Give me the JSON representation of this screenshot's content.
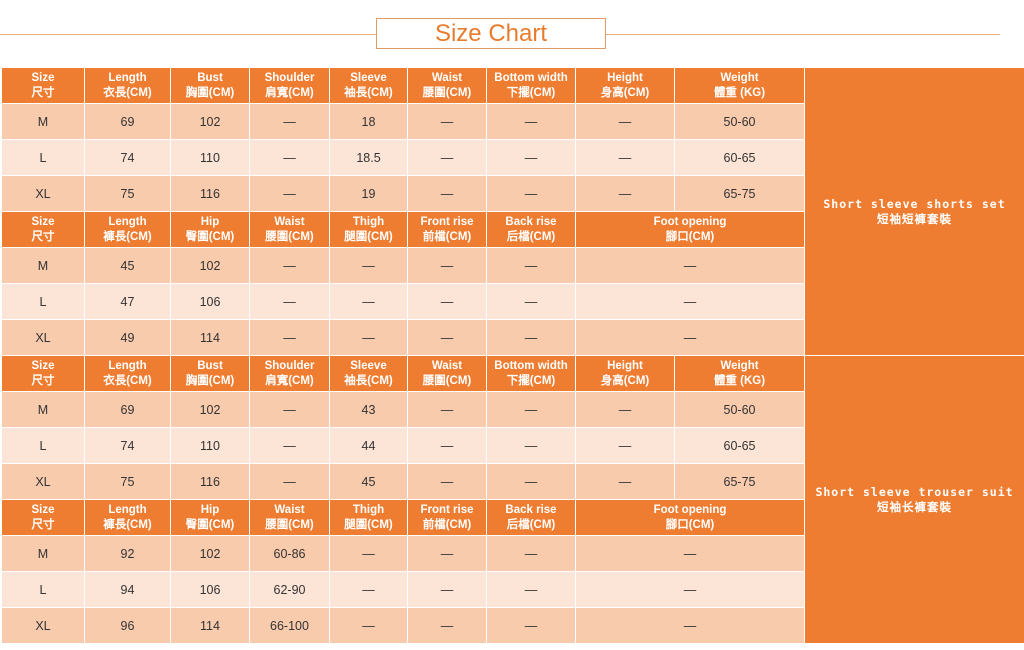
{
  "title": "Size Chart",
  "sets": [
    {
      "label_en": "Short sleeve shorts set",
      "label_zh": "短袖短褲套裝",
      "tables": [
        {
          "headers": [
            {
              "en": "Size",
              "zh": "尺寸",
              "span": 1
            },
            {
              "en": "Length",
              "zh": "衣長(CM)",
              "span": 1
            },
            {
              "en": "Bust",
              "zh": "胸圍(CM)",
              "span": 1
            },
            {
              "en": "Shoulder",
              "zh": "肩寬(CM)",
              "span": 1
            },
            {
              "en": "Sleeve",
              "zh": "袖長(CM)",
              "span": 1
            },
            {
              "en": "Waist",
              "zh": "腰圍(CM)",
              "span": 1
            },
            {
              "en": "Bottom width",
              "zh": "下擺(CM)",
              "span": 1
            },
            {
              "en": "Height",
              "zh": "身高(CM)",
              "span": 1
            },
            {
              "en": "Weight",
              "zh": "體重 (KG)",
              "span": 1
            }
          ],
          "rows": [
            {
              "cells": [
                "M",
                "69",
                "102",
                "—",
                "18",
                "—",
                "—",
                "—",
                "50-60"
              ]
            },
            {
              "cells": [
                "L",
                "74",
                "110",
                "—",
                "18.5",
                "—",
                "—",
                "—",
                "60-65"
              ]
            },
            {
              "cells": [
                "XL",
                "75",
                "116",
                "—",
                "19",
                "—",
                "—",
                "—",
                "65-75"
              ]
            }
          ]
        },
        {
          "headers": [
            {
              "en": "Size",
              "zh": "尺寸",
              "span": 1
            },
            {
              "en": "Length",
              "zh": "褲長(CM)",
              "span": 1
            },
            {
              "en": "Hip",
              "zh": "臀圍(CM)",
              "span": 1
            },
            {
              "en": "Waist",
              "zh": "腰圍(CM)",
              "span": 1
            },
            {
              "en": "Thigh",
              "zh": "腿圍(CM)",
              "span": 1
            },
            {
              "en": "Front rise",
              "zh": "前檔(CM)",
              "span": 1
            },
            {
              "en": "Back rise",
              "zh": "后檔(CM)",
              "span": 1
            },
            {
              "en": "Foot opening",
              "zh": "腳口(CM)",
              "span": 2
            }
          ],
          "rows": [
            {
              "cells": [
                "M",
                "45",
                "102",
                "—",
                "—",
                "—",
                "—",
                "—"
              ]
            },
            {
              "cells": [
                "L",
                "47",
                "106",
                "—",
                "—",
                "—",
                "—",
                "—"
              ]
            },
            {
              "cells": [
                "XL",
                "49",
                "114",
                "—",
                "—",
                "—",
                "—",
                "—"
              ]
            }
          ]
        }
      ]
    },
    {
      "label_en": "Short sleeve trouser suit",
      "label_zh": "短袖长褲套裝",
      "tables": [
        {
          "headers": [
            {
              "en": "Size",
              "zh": "尺寸",
              "span": 1
            },
            {
              "en": "Length",
              "zh": "衣長(CM)",
              "span": 1
            },
            {
              "en": "Bust",
              "zh": "胸圍(CM)",
              "span": 1
            },
            {
              "en": "Shoulder",
              "zh": "肩寬(CM)",
              "span": 1
            },
            {
              "en": "Sleeve",
              "zh": "袖長(CM)",
              "span": 1
            },
            {
              "en": "Waist",
              "zh": "腰圍(CM)",
              "span": 1
            },
            {
              "en": "Bottom width",
              "zh": "下擺(CM)",
              "span": 1
            },
            {
              "en": "Height",
              "zh": "身高(CM)",
              "span": 1
            },
            {
              "en": "Weight",
              "zh": "體重 (KG)",
              "span": 1
            }
          ],
          "rows": [
            {
              "cells": [
                "M",
                "69",
                "102",
                "—",
                "43",
                "—",
                "—",
                "—",
                "50-60"
              ]
            },
            {
              "cells": [
                "L",
                "74",
                "110",
                "—",
                "44",
                "—",
                "—",
                "—",
                "60-65"
              ]
            },
            {
              "cells": [
                "XL",
                "75",
                "116",
                "—",
                "45",
                "—",
                "—",
                "—",
                "65-75"
              ]
            }
          ]
        },
        {
          "headers": [
            {
              "en": "Size",
              "zh": "尺寸",
              "span": 1
            },
            {
              "en": "Length",
              "zh": "褲長(CM)",
              "span": 1
            },
            {
              "en": "Hip",
              "zh": "臀圍(CM)",
              "span": 1
            },
            {
              "en": "Waist",
              "zh": "腰圍(CM)",
              "span": 1
            },
            {
              "en": "Thigh",
              "zh": "腿圍(CM)",
              "span": 1
            },
            {
              "en": "Front rise",
              "zh": "前檔(CM)",
              "span": 1
            },
            {
              "en": "Back rise",
              "zh": "后檔(CM)",
              "span": 1
            },
            {
              "en": "Foot opening",
              "zh": "腳口(CM)",
              "span": 2
            }
          ],
          "rows": [
            {
              "cells": [
                "M",
                "92",
                "102",
                "60-86",
                "—",
                "—",
                "—",
                "—"
              ]
            },
            {
              "cells": [
                "L",
                "94",
                "106",
                "62-90",
                "—",
                "—",
                "—",
                "—"
              ]
            },
            {
              "cells": [
                "XL",
                "96",
                "114",
                "66-100",
                "—",
                "—",
                "—",
                "—"
              ]
            }
          ]
        }
      ]
    }
  ],
  "colors": {
    "header": "#ee7d31",
    "row_dark": "#f8cbad",
    "row_light": "#fce4d6",
    "title_text": "#e87b2c"
  }
}
